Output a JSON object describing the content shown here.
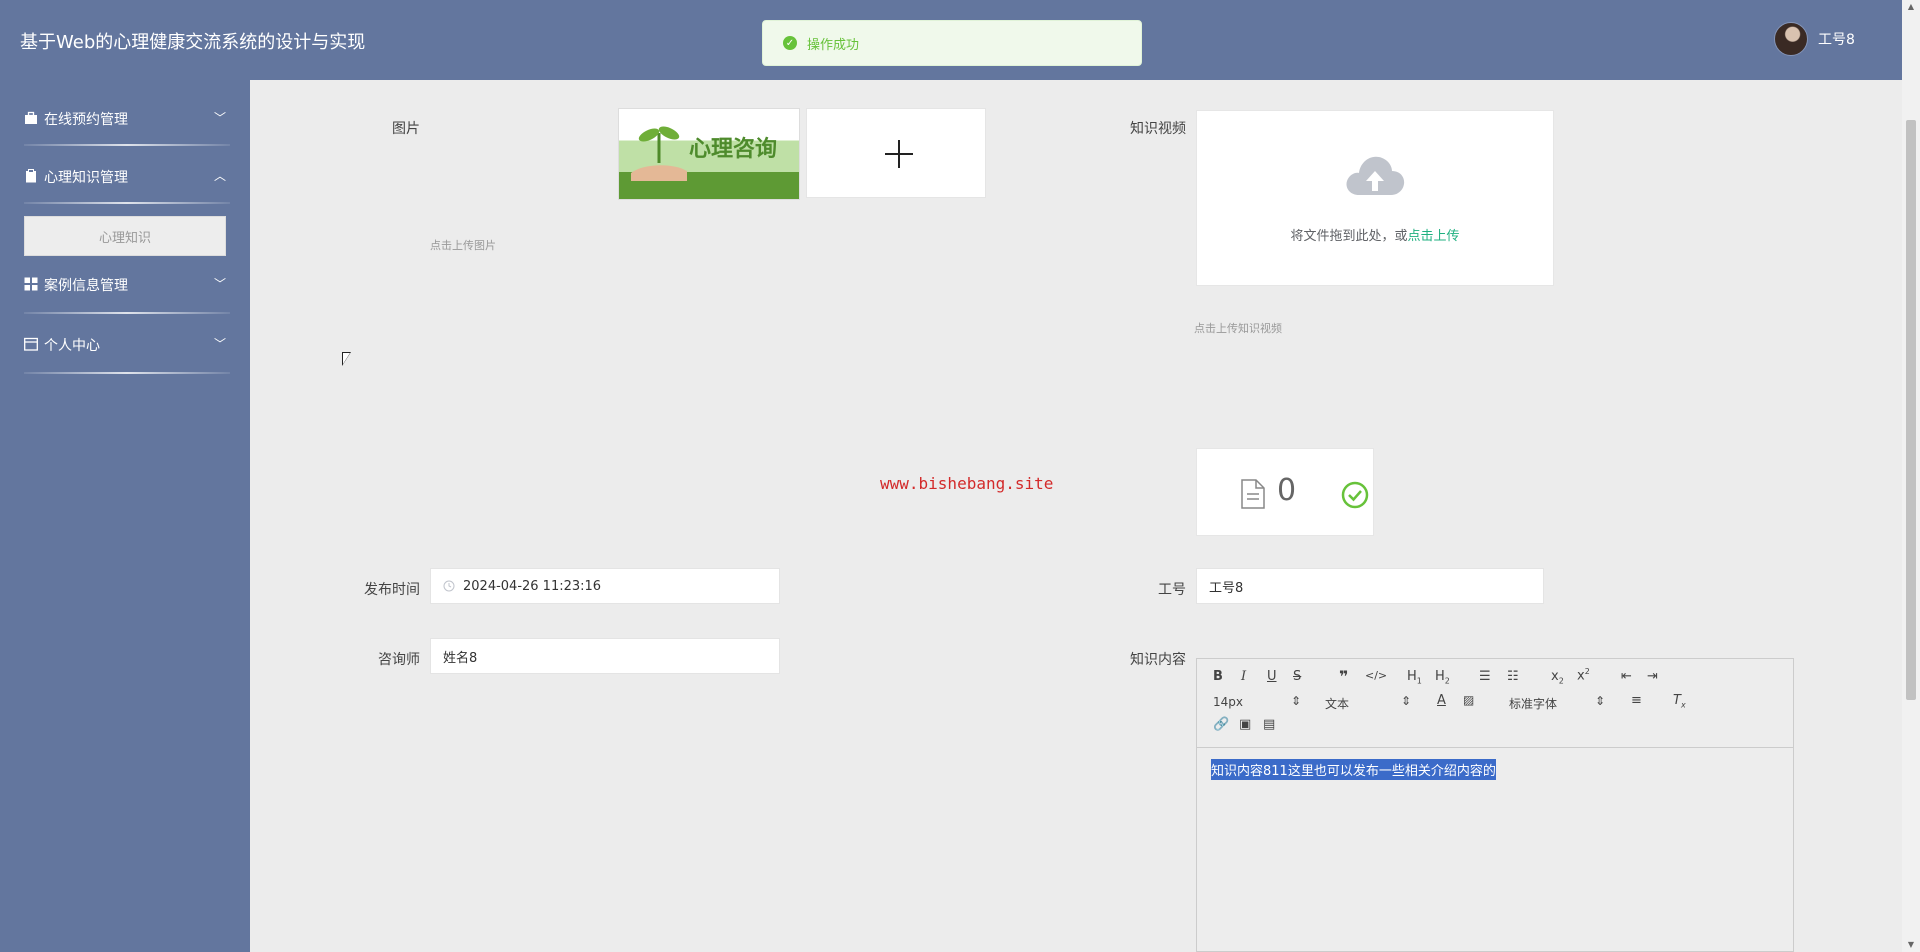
{
  "app": {
    "title": "基于Web的心理健康交流系统的设计与实现"
  },
  "user": {
    "name": "工号8"
  },
  "toast": {
    "message": "操作成功"
  },
  "sidebar": {
    "items": [
      {
        "label": "在线预约管理"
      },
      {
        "label": "心理知识管理"
      },
      {
        "label": "案例信息管理"
      },
      {
        "label": "个人中心"
      }
    ],
    "submenu": {
      "label": "心理知识"
    }
  },
  "form": {
    "image_label": "图片",
    "image_hint": "点击上传图片",
    "thumb_text": "心理咨询",
    "video_label": "知识视频",
    "video_upload_text": "将文件拖到此处，或",
    "video_upload_link": "点击上传",
    "video_hint": "点击上传知识视频",
    "file_count": "0",
    "publish_label": "发布时间",
    "publish_value": "2024-04-26 11:23:16",
    "job_label": "工号",
    "job_value": "工号8",
    "counselor_label": "咨询师",
    "counselor_value": "姓名8",
    "content_label": "知识内容"
  },
  "editor": {
    "font_size": "14px",
    "paragraph": "文本",
    "font_family": "标准字体",
    "content": "知识内容811这里也可以发布一些相关介绍内容的"
  },
  "watermark": "www.bishebang.site",
  "colors": {
    "header": "#63769e",
    "success": "#67c23a",
    "link": "#20b080"
  }
}
